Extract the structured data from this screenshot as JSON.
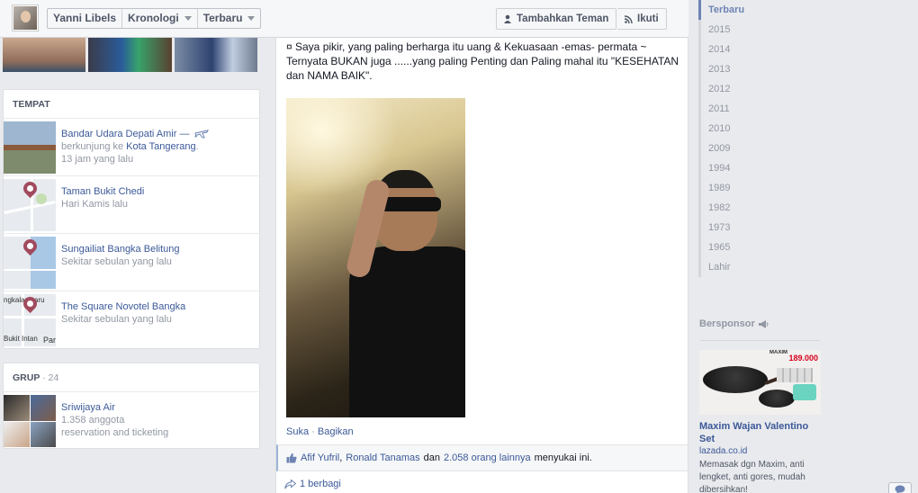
{
  "topbar": {
    "name": "Yanni Libels",
    "section": "Kronologi",
    "sort": "Terbaru",
    "add_friend": "Tambahkan Teman",
    "follow": "Ikuti"
  },
  "places": {
    "title": "TEMPAT",
    "items": [
      {
        "name": "Bandar Udara Depati Amir —",
        "sub_prefix": "berkunjung ke ",
        "sub_link": "Kota Tangerang",
        "sub_suffix": ".",
        "time": "13 jam yang lalu"
      },
      {
        "name": "Taman Bukit Chedi",
        "time": "Hari Kamis lalu"
      },
      {
        "name": "Sungailiat Bangka Belitung",
        "time": "Sekitar sebulan yang lalu"
      },
      {
        "name": "The Square Novotel Bangka",
        "time": "Sekitar sebulan yang lalu"
      }
    ],
    "map_labels": {
      "a": "ngkalan",
      "b": "aru",
      "c": "Bukit Intan",
      "d": "Par"
    }
  },
  "groups": {
    "title": "GRUP",
    "count": "· 24",
    "items": [
      {
        "name": "Sriwijaya Air",
        "members": "1.358 anggota",
        "desc": "reservation and ticketing"
      }
    ]
  },
  "post": {
    "text": "¤ Saya pikir, yang paling berharga itu uang & Kekuasaan -emas- permata ~ Ternyata BUKAN juga ......yang paling Penting dan Paling mahal itu \"KESEHATAN dan NAMA BAIK\".",
    "like": "Suka",
    "dot": "·",
    "share": "Bagikan",
    "likes": {
      "p1": "Afif Yufril",
      "sep": ",",
      "p2": "Ronald Tanamas",
      "and": "dan",
      "others": "2.058 orang lainnya",
      "suffix": "menyukai ini."
    },
    "shares": "1 berbagi"
  },
  "years": [
    "Terbaru",
    "2015",
    "2014",
    "2013",
    "2012",
    "2011",
    "2010",
    "2009",
    "1994",
    "1989",
    "1982",
    "1973",
    "1965",
    "Lahir"
  ],
  "sponsor": {
    "heading": "Bersponsor",
    "brand": "MAXIM",
    "price": "189.000",
    "title": "Maxim Wajan Valentino Set",
    "domain": "lazada.co.id",
    "desc": "Memasak dgn Maxim, anti lengket, anti gores, mudah dibersihkan!"
  },
  "colors": {
    "link": "#3b5998",
    "grey": "#9197a3",
    "bg": "#e9eaed",
    "pin": "#a14a5e"
  }
}
